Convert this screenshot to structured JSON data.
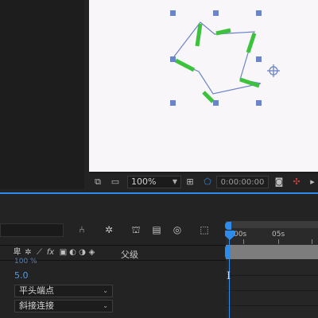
{
  "viewer": {
    "zoom": "100%",
    "timecode": "0:00:00:00"
  },
  "timeline": {
    "ruler": {
      "start_label": "00s",
      "mark_label": "05s"
    },
    "columns": {
      "parent_label": "父级"
    },
    "properties": {
      "cut_value": "100 %",
      "stroke_width": "5.0",
      "line_cap": "平头端点",
      "line_join": "斜接连接"
    }
  },
  "colors": {
    "accent_blue": "#2d8ceb",
    "stroke_green": "#3cc23c",
    "path_blue": "#6c84c8"
  }
}
